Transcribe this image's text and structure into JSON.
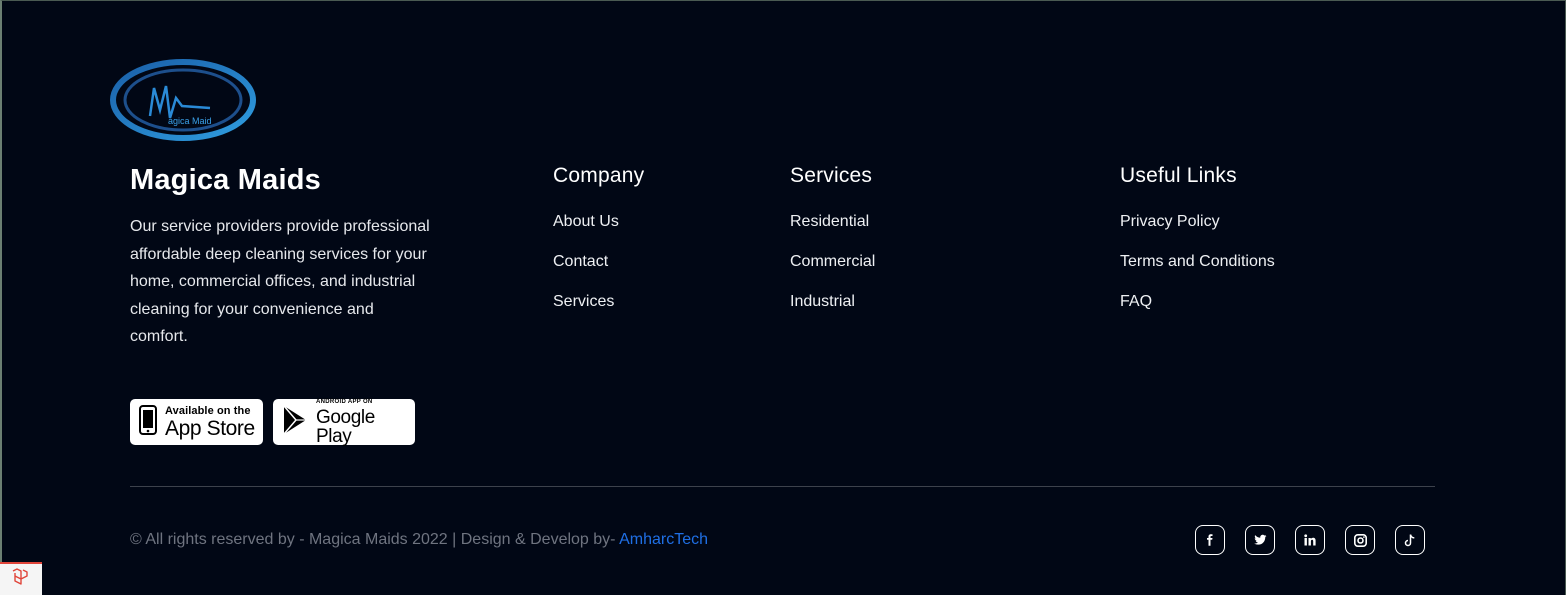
{
  "logo": {
    "text": "agica Maid",
    "icon": "magica-maids-logo"
  },
  "brand": {
    "title": "Magica Maids",
    "description": "Our service providers provide professional affordable deep cleaning services for your home, commercial offices, and industrial cleaning for your convenience and comfort."
  },
  "badges": {
    "appstore": {
      "small": "Available on the",
      "big": "App Store",
      "icon": "apple-phone-icon"
    },
    "googleplay": {
      "small": "ANDROID APP ON",
      "big": "Google Play",
      "icon": "google-play-icon"
    }
  },
  "columns": {
    "company": {
      "heading": "Company",
      "items": [
        "About Us",
        "Contact",
        "Services"
      ]
    },
    "services": {
      "heading": "Services",
      "items": [
        "Residential",
        "Commercial",
        "Industrial"
      ]
    },
    "useful": {
      "heading": "Useful Links",
      "items": [
        "Privacy Policy",
        "Terms and Conditions",
        "FAQ"
      ]
    }
  },
  "footer": {
    "copyright": "© All rights reserved by - Magica Maids 2022 | Design & Develop by- ",
    "developer": "AmharcTech"
  },
  "socials": [
    {
      "name": "facebook",
      "glyph": "f"
    },
    {
      "name": "twitter",
      "glyph": ""
    },
    {
      "name": "linkedin",
      "glyph": "in"
    },
    {
      "name": "instagram",
      "glyph": ""
    },
    {
      "name": "tiktok",
      "glyph": ""
    }
  ],
  "colors": {
    "background": "#010715",
    "link_accent": "#1f6fe5",
    "logo_blue": "#2a8ad6"
  }
}
